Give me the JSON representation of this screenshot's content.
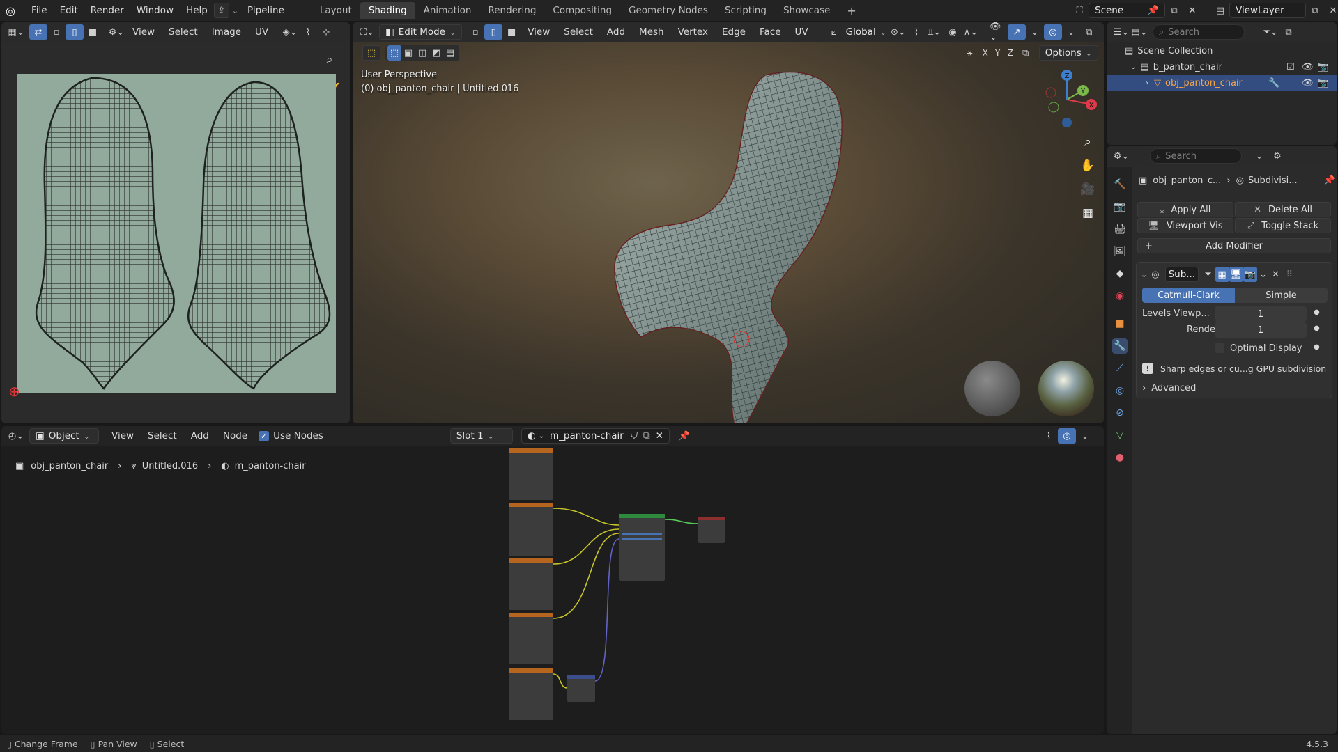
{
  "app": {
    "menus": [
      "File",
      "Edit",
      "Render",
      "Window",
      "Help",
      "Pipeline"
    ],
    "workspaces": [
      "Layout",
      "Shading",
      "Animation",
      "Rendering",
      "Compositing",
      "Geometry Nodes",
      "Scripting",
      "Showcase"
    ],
    "active_workspace": "Shading",
    "scene": "Scene",
    "view_layer": "ViewLayer",
    "version": "4.5.3"
  },
  "uv_editor": {
    "menus": [
      "View",
      "Select",
      "Image",
      "UV"
    ]
  },
  "viewport": {
    "mode": "Edit Mode",
    "menus": [
      "View",
      "Select",
      "Add",
      "Mesh",
      "Vertex",
      "Edge",
      "Face",
      "UV"
    ],
    "transform_orientation": "Global",
    "options_label": "Options",
    "axes": [
      "X",
      "Y",
      "Z"
    ],
    "overlay_title": "User Perspective",
    "overlay_subtitle": "(0) obj_panton_chair | Untitled.016",
    "gizmo_labels": {
      "x": "X",
      "y": "Y",
      "z": "Z"
    },
    "colors": {
      "x": "#e0394a",
      "y": "#7ab84a",
      "z": "#3c7fd0"
    }
  },
  "outliner": {
    "search_placeholder": "Search",
    "items": [
      {
        "label": "Scene Collection"
      },
      {
        "label": "b_panton_chair"
      },
      {
        "label": "obj_panton_chair"
      }
    ]
  },
  "properties": {
    "search_placeholder": "Search",
    "breadcrumb_object": "obj_panton_c...",
    "breadcrumb_modifier": "Subdivisi...",
    "apply_all": "Apply All",
    "delete_all": "Delete All",
    "viewport_vis": "Viewport Vis",
    "toggle_stack": "Toggle Stack",
    "add_modifier": "Add Modifier",
    "modifier": {
      "name": "Sub...",
      "method_catmull": "Catmull-Clark",
      "method_simple": "Simple",
      "levels_viewport_label": "Levels Viewp...",
      "levels_viewport": "1",
      "render_label": "Render",
      "render_levels": "1",
      "optimal_display": "Optimal Display",
      "info": "Sharp edges or cu...g GPU subdivision",
      "advanced": "Advanced"
    }
  },
  "node_editor": {
    "type": "Object",
    "menus": [
      "View",
      "Select",
      "Add",
      "Node"
    ],
    "use_nodes": "Use Nodes",
    "slot": "Slot 1",
    "material": "m_panton-chair",
    "breadcrumb": [
      "obj_panton_chair",
      "Untitled.016",
      "m_panton-chair"
    ]
  },
  "status_bar": {
    "items": [
      "Change Frame",
      "Pan View",
      "Select"
    ]
  }
}
